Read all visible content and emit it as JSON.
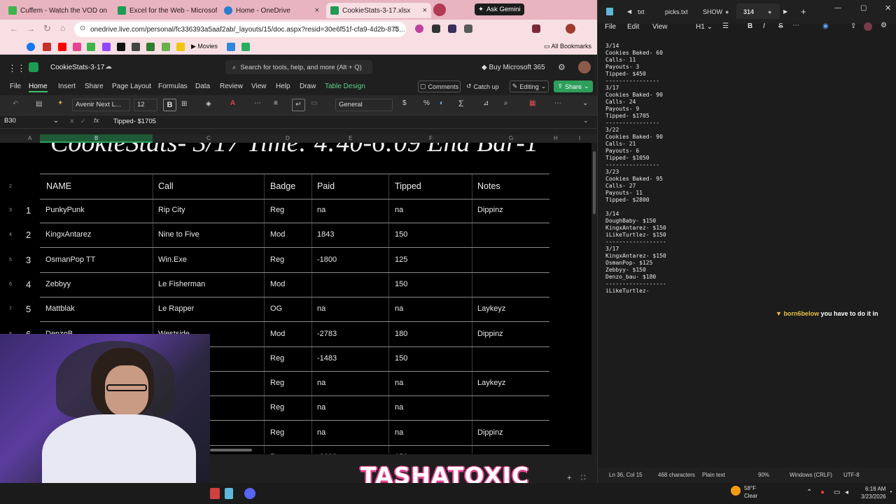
{
  "browser": {
    "tabs": [
      {
        "label": "Cuffem - Watch the VOD on",
        "color": "#3bb54a"
      },
      {
        "label": "Excel for the Web - Microsoft",
        "color": "#1f9a55"
      },
      {
        "label": "Home - OneDrive",
        "color": "#2b7cd3"
      },
      {
        "label": "CookieStats-3-17.xlsx",
        "color": "#1f9a55"
      }
    ],
    "ask_gemini": "Ask Gemini",
    "url": "onedrive.live.com/personal/fc336393a5aaf2ab/_layouts/15/doc.aspx?resid=30e6f51f-cfa9-4d2b-875...",
    "bookmarks_movies": "Movies",
    "all_bookmarks": "All Bookmarks"
  },
  "excel": {
    "file_name": "CookieStats-3-17",
    "search_placeholder": "Search for tools, help, and more (Alt + Q)",
    "buy": "Buy Microsoft 365",
    "ribbon_tabs": [
      "File",
      "Home",
      "Insert",
      "Share",
      "Page Layout",
      "Formulas",
      "Data",
      "Review",
      "View",
      "Help",
      "Draw",
      "Table Design"
    ],
    "comments": "Comments",
    "catch_up": "Catch up",
    "editing": "Editing",
    "share": "Share",
    "font_name": "Avenir Next L...",
    "font_size": "12",
    "number_format": "General",
    "name_box": "B30",
    "formula_value": "Tipped- $1705",
    "fx": "fx",
    "columns": [
      "A",
      "B",
      "C",
      "D",
      "E",
      "F",
      "G",
      "H",
      "I"
    ],
    "title": "CookieStats- 3/17 Time: 4:40-6:09 End Bar-1",
    "headers": [
      "NAME",
      "Call",
      "Badge",
      "Paid",
      "Tipped",
      "Notes"
    ],
    "rows": [
      {
        "row": "3",
        "num": "1",
        "name": "PunkyPunk",
        "call": "Rip City",
        "badge": "Reg",
        "paid": "na",
        "tipped": "na",
        "notes": "Dippinz"
      },
      {
        "row": "4",
        "num": "2",
        "name": "KingxAntarez",
        "call": "Nine to Five",
        "badge": "Mod",
        "paid": "1843",
        "tipped": "150",
        "notes": ""
      },
      {
        "row": "5",
        "num": "3",
        "name": "OsmanPop TT",
        "call": "Win.Exe",
        "badge": "Reg",
        "paid": "-1800",
        "tipped": "125",
        "notes": ""
      },
      {
        "row": "6",
        "num": "4",
        "name": "Zebbyy",
        "call": "Le Fisherman",
        "badge": "Mod",
        "paid": "",
        "tipped": "150",
        "notes": ""
      },
      {
        "row": "7",
        "num": "5",
        "name": "Mattblak",
        "call": "Le Rapper",
        "badge": "OG",
        "paid": "na",
        "tipped": "na",
        "notes": "Laykeyz"
      },
      {
        "row": "8",
        "num": "6",
        "name": "DenzoB",
        "call": "Westside",
        "badge": "Mod",
        "paid": "-2783",
        "tipped": "180",
        "notes": "Dippinz"
      },
      {
        "row": "9",
        "num": "",
        "name": "",
        "call": "",
        "badge": "Reg",
        "paid": "-1483",
        "tipped": "150",
        "notes": ""
      },
      {
        "row": "10",
        "num": "",
        "name": "",
        "call": "",
        "badge": "Reg",
        "paid": "na",
        "tipped": "na",
        "notes": "Laykeyz"
      },
      {
        "row": "11",
        "num": "",
        "name": "",
        "call": "",
        "badge": "Reg",
        "paid": "na",
        "tipped": "na",
        "notes": ""
      },
      {
        "row": "12",
        "num": "",
        "name": "",
        "call": "rge",
        "badge": "Reg",
        "paid": "na",
        "tipped": "na",
        "notes": "Dippinz"
      },
      {
        "row": "13",
        "num": "",
        "name": "",
        "call": "",
        "badge": "Reg",
        "paid": "-2300",
        "tipped": "150",
        "notes": ""
      }
    ]
  },
  "notepad": {
    "tabs": [
      "txt",
      "picks.txt",
      "SHOW",
      "314"
    ],
    "menu": [
      "File",
      "Edit",
      "View"
    ],
    "heading": "H1",
    "text": "3/14\nCookies Baked- 60\nCalls- 11\nPayouts- 3\nTipped- $450\n----------------\n3/17\nCookies Baked- 90\nCalls- 24\nPayouts- 9\nTipped- $1705\n----------------\n3/22\nCookies Baked- 90\nCalls- 21\nPayouts- 6\nTipped- $1050\n----------------\n3/23\nCookies Baked- 95\nCalls- 27\nPayouts- 11\nTipped- $2800\n\n3/14\nDoughBaby- $150\nKingxAntarez- $150\niLikeTurtlez- $150\n------------------\n3/17\nKingxAntarez- $150\nOsmanPop- $125\nZebbyy- $150\nDenzo_bau- $180\n------------------\niLikeTurtlez-",
    "status": {
      "pos": "Ln 36, Col 15",
      "chars": "468 characters",
      "type": "Plain text",
      "zoom": "90%",
      "eol": "Windows (CRLF)",
      "enc": "UTF-8"
    }
  },
  "chat": {
    "user": "born6below",
    "message": "you have to do it in"
  },
  "overlay": {
    "brand": "TASHATOXIC"
  },
  "taskbar": {
    "temp": "58°F",
    "weather": "Clear",
    "time": "6:18 AM",
    "date": "3/23/2026"
  }
}
